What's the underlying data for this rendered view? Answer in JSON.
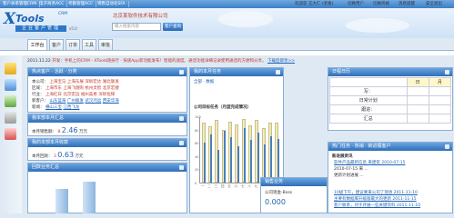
{
  "topbar": {
    "tabs": [
      "客户关系管理CRM",
      "电子商务ACC",
      "考勤管理ACC",
      "销售自动化SFA"
    ],
    "user": "欢迎您 王大仁 (老板)",
    "links": [
      "切换用户",
      "切换风格",
      "消息提醒",
      "安全退出"
    ]
  },
  "logo": {
    "brand_x": "X",
    "brand_tools": "Tools",
    "brand_crm": "CRM",
    "subtitle": "企业客户管理",
    "version": "v5.0"
  },
  "header": {
    "company": "北京某软件技术有限公司",
    "search_placeholder": "输入搜索内容",
    "search_button": "客户查询"
  },
  "nav": {
    "tabs": [
      "工作台",
      "客户",
      "订单",
      "工具",
      "审批"
    ],
    "active": 0
  },
  "notice": {
    "date": "2011.11.22",
    "text": "开发：手机上的CRM - XTools随身行 · 快速App新功能发布！智能的速度。通话功能详细记录使用通话的方便和分享。",
    "link": "下载后即享>>"
  },
  "panels": {
    "hot_customers": {
      "title": "热点客户 · 活跃 · 分类",
      "rows": [
        {
          "label": "本公司：",
          "items": [
            "上海宝马",
            "上海东展",
            "深圳宏达",
            "湖北联发"
          ]
        },
        {
          "label": "区域：",
          "items": [
            "上海市东",
            "上海飞翔购",
            "杭州灵智",
            "北京宏捷"
          ]
        },
        {
          "label": "行业：",
          "items": [
            "上海红日",
            "北京宏远",
            "福州美易",
            "深圳恒辉"
          ]
        },
        {
          "label": "新客户：",
          "items": [
            "山东蓝海",
            "广州联发",
            "武汉鸿远",
            "西安华海"
          ]
        },
        {
          "label": "新闻：",
          "items": [
            "横山三宝",
            "江西飞龙"
          ]
        }
      ]
    },
    "my_sales": {
      "title": "我本部本月汇总",
      "label": "本月销售额：",
      "count": "8",
      "amount": "2.46",
      "unit": "万元"
    },
    "my_receipts": {
      "title": "我的本部本月收款",
      "label": "本月回款：",
      "count": "3",
      "amount": "0.63",
      "unit": "万元"
    },
    "chart_panel": {
      "title": "我的本月任务",
      "subtitle": "公司目标任务（月度完成情况）",
      "tab": "全部 · 数据"
    },
    "calendar": {
      "title": "日程日历",
      "headers": [
        "",
        "日",
        "月"
      ],
      "rows": [
        [
          "写：",
          "",
          ""
        ],
        [
          "日常计划",
          "",
          ""
        ],
        [
          "跟进：",
          "",
          ""
        ],
        [
          "汇总",
          "",
          ""
        ]
      ]
    },
    "top_customers": {
      "title": "热门任务 · 热销 · 新进展客户",
      "header": "新进展资讯",
      "items": [
        {
          "text": "软件产品最新信息 来建筑 2010-07-15"
        },
        {
          "text": "2010-07-15 来 ..."
        },
        {
          "text": "更新计划进展 ..."
        },
        {
          "text": "10级下午，建议要来公司了现场 2011-11-10"
        },
        {
          "text": "主要有数据库升级版最大的更新 2011-11-15"
        },
        {
          "text": "客户联系，对于开展一些关键资料 2011-11-10"
        }
      ]
    },
    "todo": {
      "title": "销售业务",
      "sub": "公司现金-Boss",
      "count": "0.000"
    },
    "bottom_chart": {
      "title": "回款业务汇总"
    }
  },
  "chart_data": {
    "type": "bar",
    "title": "公司目标任务（月度完成情况）",
    "categories": [
      "一",
      "二",
      "三",
      "四",
      "五",
      "六",
      "七",
      "八",
      "九",
      "十",
      "十一",
      "十二"
    ],
    "series": [
      {
        "name": "目标",
        "values": [
          90,
          85,
          95,
          80,
          92,
          88,
          96,
          86,
          94,
          82,
          90,
          91
        ]
      },
      {
        "name": "完成",
        "values": [
          60,
          72,
          50,
          78,
          68,
          55,
          82,
          64,
          75,
          58,
          70,
          66
        ]
      }
    ],
    "ylim": [
      0,
      100
    ],
    "yticks": [
      "100",
      "80",
      "60",
      "40",
      "20",
      "0"
    ]
  }
}
